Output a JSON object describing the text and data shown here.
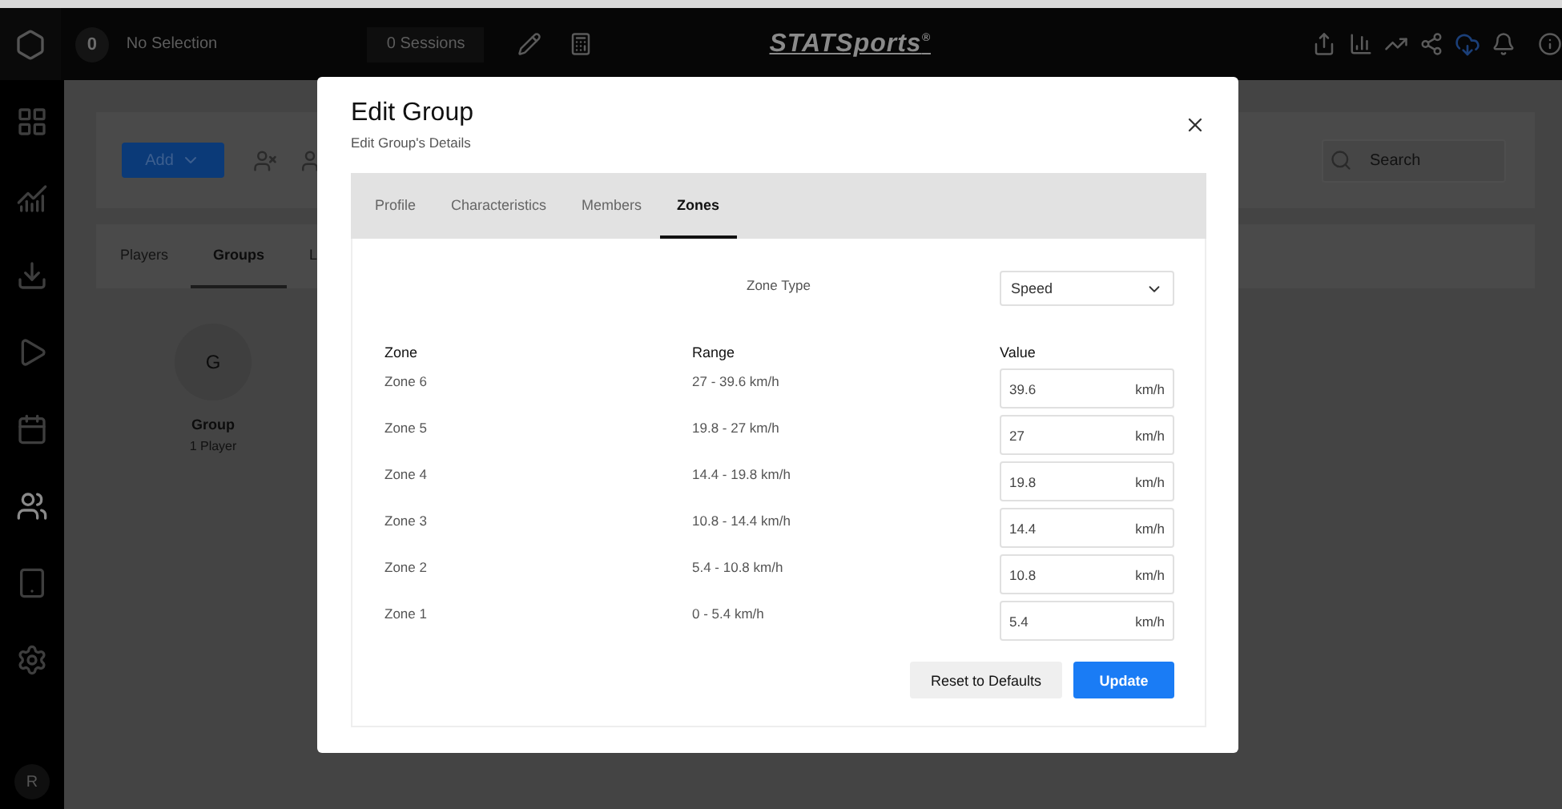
{
  "top_bar": {
    "selection_count": "0",
    "selection_label": "No Selection",
    "sessions": "0 Sessions",
    "logo": "STATSports$^{®}$"
  },
  "sidebar": {
    "items": [
      {
        "selected": false
      },
      {
        "selected": false
      },
      {
        "selected": false
      },
      {
        "selected": false
      },
      {
        "selected": false
      },
      {
        "selected": true
      },
      {
        "selected": false
      },
      {
        "selected": false
      }
    ],
    "avatar": "R"
  },
  "toolbar": {
    "add_button": "Add",
    "search_placeholder": "Search"
  },
  "tabs": [
    {
      "label": "Players",
      "selected": false
    },
    {
      "label": "Groups",
      "selected": true
    },
    {
      "label": "L",
      "selected": false
    }
  ],
  "groups": [
    {
      "initial": "G",
      "name": "Group",
      "count": "1 Player"
    }
  ],
  "modal": {
    "title": "Edit Group",
    "subtitle": "Edit Group's Details",
    "tabs": [
      {
        "label": "Profile",
        "selected": false
      },
      {
        "label": "Characteristics",
        "selected": false
      },
      {
        "label": "Members",
        "selected": false
      },
      {
        "label": "Zones",
        "selected": true
      }
    ],
    "zone_type": {
      "label": "Zone Type",
      "value": "Speed"
    },
    "columns": [
      "Zone",
      "Range",
      "Value"
    ],
    "zones": [
      {
        "name": "Zone 6",
        "range": "27 - 39.6 km/h",
        "value": "39.6",
        "unit": "km/h"
      },
      {
        "name": "Zone 5",
        "range": "19.8 - 27 km/h",
        "value": "27",
        "unit": "km/h"
      },
      {
        "name": "Zone 4",
        "range": "14.4 - 19.8 km/h",
        "value": "19.8",
        "unit": "km/h"
      },
      {
        "name": "Zone 3",
        "range": "10.8 - 14.4 km/h",
        "value": "14.4",
        "unit": "km/h"
      },
      {
        "name": "Zone 2",
        "range": "5.4 - 10.8 km/h",
        "value": "10.8",
        "unit": "km/h"
      },
      {
        "name": "Zone 1",
        "range": "0 - 5.4 km/h",
        "value": "5.4",
        "unit": "km/h"
      }
    ],
    "buttons": {
      "reset": "Reset to Defaults",
      "update": "Update"
    }
  }
}
